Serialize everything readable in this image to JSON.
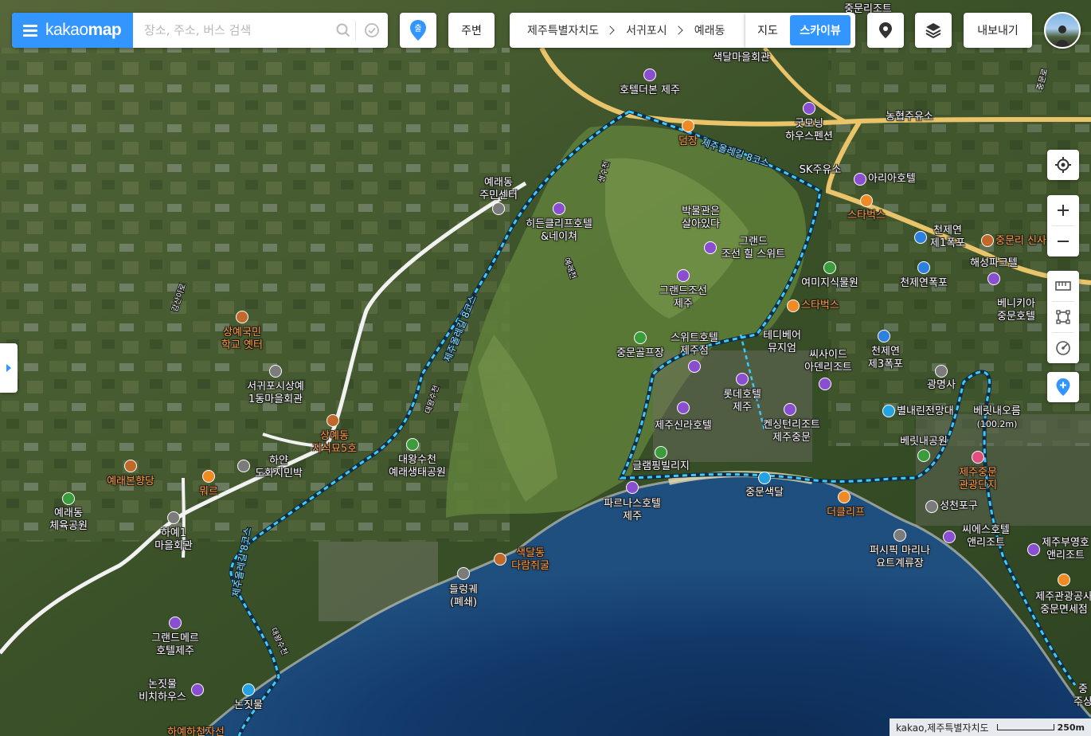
{
  "brand": {
    "logo_regular": "kakao",
    "logo_bold": "map"
  },
  "search": {
    "placeholder": "장소, 주소, 버스 검색"
  },
  "toolbar": {
    "start_label": "출",
    "nearby_label": "주변",
    "breadcrumb": [
      "제주특별자치도",
      "서귀포시",
      "예래동"
    ],
    "map_type_map": "지도",
    "map_type_skyview": "스카이뷰",
    "export_label": "내보내기"
  },
  "map": {
    "labels": [
      {
        "text": "예래동\n주민센터",
        "style": "white"
      },
      {
        "text": "히든클리프호텔\n&네이쳐",
        "style": "white"
      },
      {
        "text": "박물관은\n살아있다",
        "style": "white"
      },
      {
        "text": "그랜드\n조선 힐 스위트",
        "style": "white"
      },
      {
        "text": "그랜드조선\n제주",
        "style": "white"
      },
      {
        "text": "호텔더본 제주",
        "style": "white"
      },
      {
        "text": "색달마을회관",
        "style": "white"
      },
      {
        "text": "덤장",
        "style": "orange"
      },
      {
        "text": "굿모닝\n하우스펜션",
        "style": "white"
      },
      {
        "text": "농협주유소",
        "style": "white"
      },
      {
        "text": "SK주유소",
        "style": "white"
      },
      {
        "text": "아리아호텔",
        "style": "white"
      },
      {
        "text": "스타벅스",
        "style": "orange"
      },
      {
        "text": "천제연\n제1폭포",
        "style": "white"
      },
      {
        "text": "중문리 신사",
        "style": "orange"
      },
      {
        "text": "해성파크텔",
        "style": "white"
      },
      {
        "text": "여미지식물원",
        "style": "white"
      },
      {
        "text": "천제연폭포",
        "style": "white"
      },
      {
        "text": "스타벅스",
        "style": "orange"
      },
      {
        "text": "베니키아\n중문호텔",
        "style": "white"
      },
      {
        "text": "테디베어\n뮤지엄",
        "style": "white"
      },
      {
        "text": "스위트호텔\n제주점",
        "style": "white"
      },
      {
        "text": "중문골프장",
        "style": "white"
      },
      {
        "text": "씨사이드\n아덴리조트",
        "style": "white"
      },
      {
        "text": "천제연\n제3폭포",
        "style": "white"
      },
      {
        "text": "광명사",
        "style": "white"
      },
      {
        "text": "롯데호텔\n제주",
        "style": "white"
      },
      {
        "text": "별내린전망대",
        "style": "white"
      },
      {
        "text": "베릿내오름",
        "style": "white"
      },
      {
        "text": "(100.2m)",
        "style": "white"
      },
      {
        "text": "켄싱턴리조트\n제주중문",
        "style": "white"
      },
      {
        "text": "제주신라호텔",
        "style": "white"
      },
      {
        "text": "베릿내공원",
        "style": "white"
      },
      {
        "text": "제주중문\n관광단지",
        "style": "orange"
      },
      {
        "text": "글램핑빌리지",
        "style": "white"
      },
      {
        "text": "중문색달",
        "style": "white"
      },
      {
        "text": "파르나스호텔\n제주",
        "style": "white"
      },
      {
        "text": "더클리프",
        "style": "orange"
      },
      {
        "text": "성천포구",
        "style": "white"
      },
      {
        "text": "씨에스호텔\n앤리조트",
        "style": "white"
      },
      {
        "text": "제주부영호\n앤리조트",
        "style": "white"
      },
      {
        "text": "퍼시픽 마리나\n요트계류장",
        "style": "white"
      },
      {
        "text": "제주관광공사\n중문면세점",
        "style": "white"
      },
      {
        "text": "대왕수천\n예래생태공원",
        "style": "white"
      },
      {
        "text": "색달동\n다람쥐굴",
        "style": "orange"
      },
      {
        "text": "들렁궤\n(폐쇄)",
        "style": "white"
      },
      {
        "text": "상예동\n지석묘5호",
        "style": "orange"
      },
      {
        "text": "상예국민\n학교 옛터",
        "style": "orange"
      },
      {
        "text": "서귀포시상예\n1동마을회관",
        "style": "white"
      },
      {
        "text": "하얀\n도화지민박",
        "style": "white"
      },
      {
        "text": "뭐르",
        "style": "orange"
      },
      {
        "text": "예래본향당",
        "style": "orange"
      },
      {
        "text": "예래동\n체육공원",
        "style": "white"
      },
      {
        "text": "하예1\n마을회관",
        "style": "white"
      },
      {
        "text": "그랜드메르\n호텔제주",
        "style": "white"
      },
      {
        "text": "논짓물\n비치하우스",
        "style": "white"
      },
      {
        "text": "논짓물",
        "style": "white"
      },
      {
        "text": "하예하천자선",
        "style": "orange"
      },
      {
        "text": "중문리조트",
        "style": "white"
      },
      {
        "text": "중문로",
        "style": "white"
      },
      {
        "text": "중\n주상",
        "style": "white"
      }
    ],
    "route_labels": [
      "제주올레길 8코스",
      "제주올레길 8코스",
      "제주올레길 8코스",
      "대왕수천",
      "예래천",
      "생수천",
      "감산이로",
      "대왕수천"
    ]
  },
  "footer": {
    "copyright": "kakao,제주특별자치도",
    "scale": "250m"
  }
}
